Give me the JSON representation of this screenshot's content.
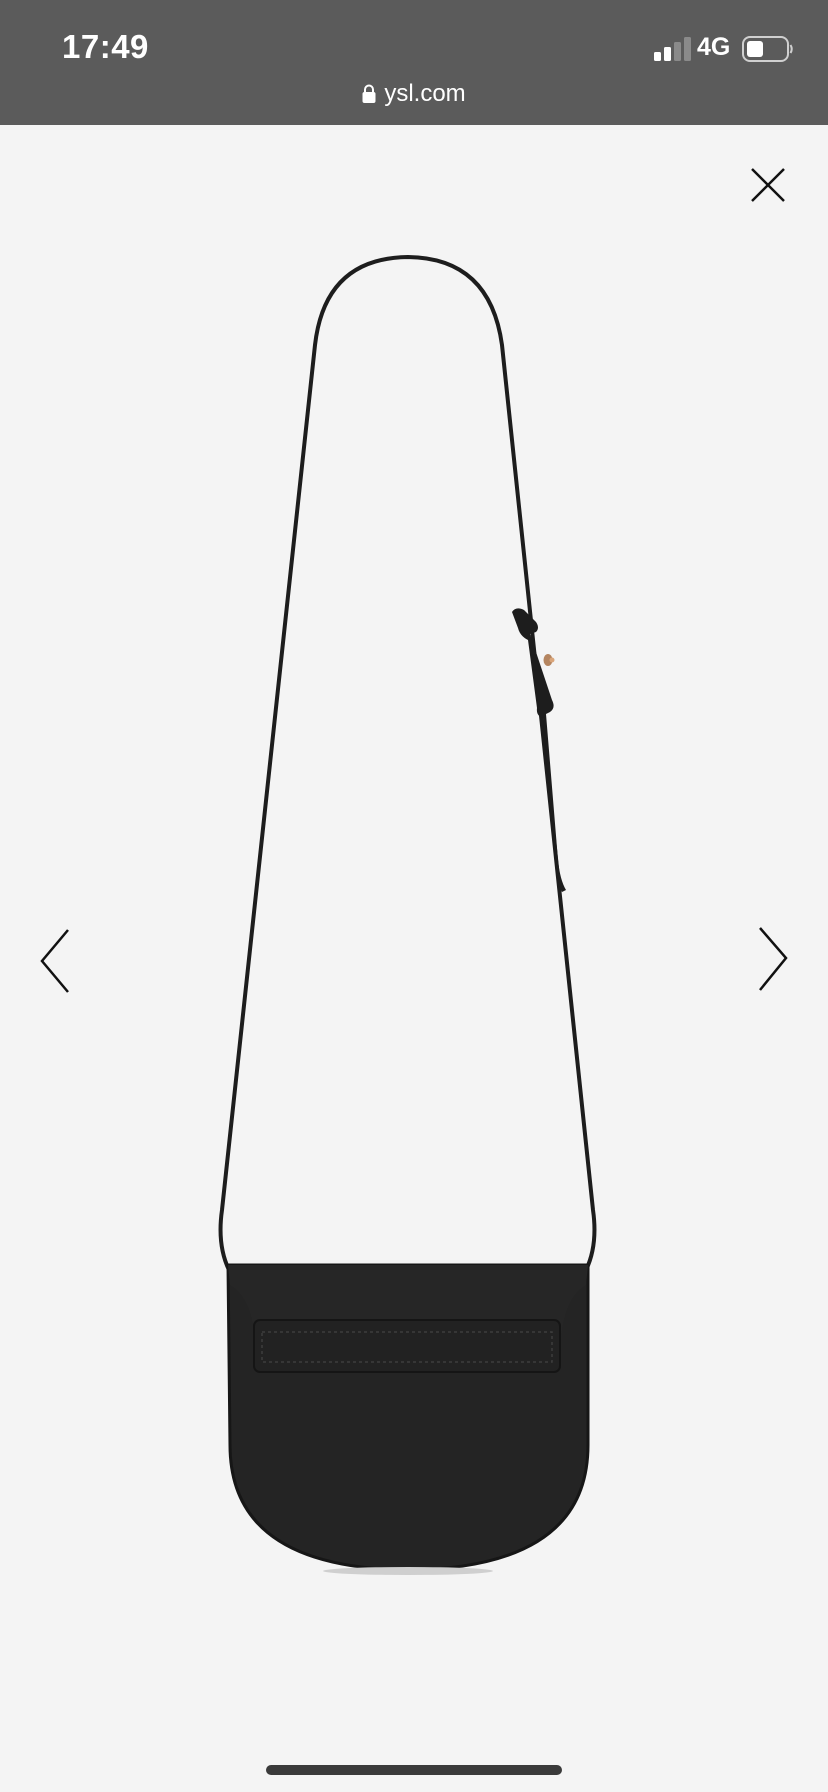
{
  "status_bar": {
    "time": "17:49",
    "network": "4G",
    "url": "ysl.com",
    "background_color": "#5b5b5b"
  },
  "viewer": {
    "background_color": "#f4f4f4",
    "close_icon": "close-icon",
    "prev_icon": "chevron-left-icon",
    "next_icon": "chevron-right-icon",
    "product_image": "black-leather-crossbody-bag"
  }
}
